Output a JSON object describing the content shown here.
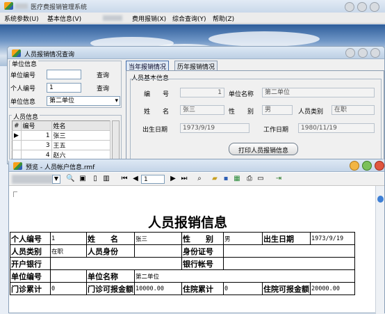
{
  "main": {
    "title": "医疗费报销管理系统",
    "menu": [
      "系统参数(U)",
      "基本信息(V)",
      "费用报销(X)",
      "综合查询(Y)",
      "帮助(Z)"
    ]
  },
  "query": {
    "title": "人员报销情况查询",
    "unit_section": "单位信息",
    "unit_no_label": "单位编号",
    "unit_no_value": "",
    "query_btn": "查询",
    "person_no_label": "个人编号",
    "person_no_value": "1",
    "query_btn2": "查询",
    "unit_info_label": "单位信息",
    "unit_info_value": "第二单位",
    "person_section": "人员信息",
    "grid_headers": [
      "#",
      "编号",
      "姓名"
    ],
    "grid_rows": [
      {
        "no": "1",
        "name": "张三"
      },
      {
        "no": "3",
        "name": "王五"
      },
      {
        "no": "4",
        "name": "赵六"
      }
    ],
    "tabs": [
      "当年报销情况",
      "历年报销情况"
    ],
    "basic_section": "人员基本信息",
    "fields": {
      "no_label": "编　　号",
      "no_value": "1",
      "unitname_label": "单位名称",
      "unitname_value": "第二单位",
      "name_label": "姓　　名",
      "name_value": "张三",
      "sex_label": "性　　别",
      "sex_value": "男",
      "cat_label": "人员类别",
      "cat_value": "在职",
      "birth_label": "出生日期",
      "birth_value": "1973/9/19",
      "work_label": "工作日期",
      "work_value": "1980/11/19"
    },
    "print_btn": "打印人员报销信息"
  },
  "preview": {
    "title": "预览 - 人员帐户信息.rmf",
    "page": "1",
    "report_title": "人员报销信息",
    "rows": [
      [
        "个人编号",
        "1",
        "姓　　名",
        "张三",
        "性　　别",
        "男",
        "出生日期",
        "1973/9/19"
      ],
      [
        "人员类别",
        "在职",
        "人员身份",
        "",
        "身份证号",
        ""
      ],
      [
        "开户银行",
        "",
        "银行帐号",
        ""
      ],
      [
        "单位编号",
        "",
        "单位名称",
        "第二单位"
      ],
      [
        "门诊累计",
        "0",
        "门诊可报金额",
        "10000.00",
        "住院累计",
        "0",
        "住院可报金额",
        "20000.00"
      ]
    ]
  },
  "colors": {
    "title_grad": "#c5d5e8",
    "accent": "#2f5fb4"
  }
}
